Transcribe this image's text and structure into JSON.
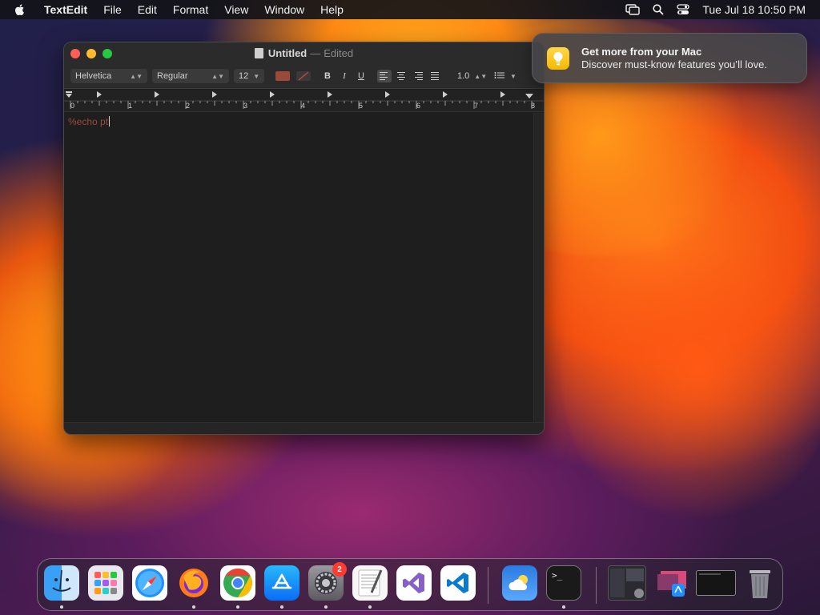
{
  "menubar": {
    "app_name": "TextEdit",
    "items": [
      "File",
      "Edit",
      "Format",
      "View",
      "Window",
      "Help"
    ],
    "clock": "Tue Jul 18  10:50 PM"
  },
  "window": {
    "title": "Untitled",
    "separator": "—",
    "status": "Edited",
    "toolbar": {
      "font_family": "Helvetica",
      "font_style": "Regular",
      "font_size": "12",
      "text_color": "#9a4a3a",
      "bold": "B",
      "italic": "I",
      "underline": "U",
      "line_spacing": "1.0"
    },
    "ruler_numbers": [
      "0",
      "1",
      "2",
      "3",
      "4",
      "5",
      "6",
      "7",
      "8"
    ],
    "content": "%echo pt"
  },
  "notification": {
    "title": "Get more from your Mac",
    "body": "Discover must-know features you’ll love."
  },
  "dock": {
    "badge_system_settings": "2",
    "terminal_prompt": ">_"
  }
}
